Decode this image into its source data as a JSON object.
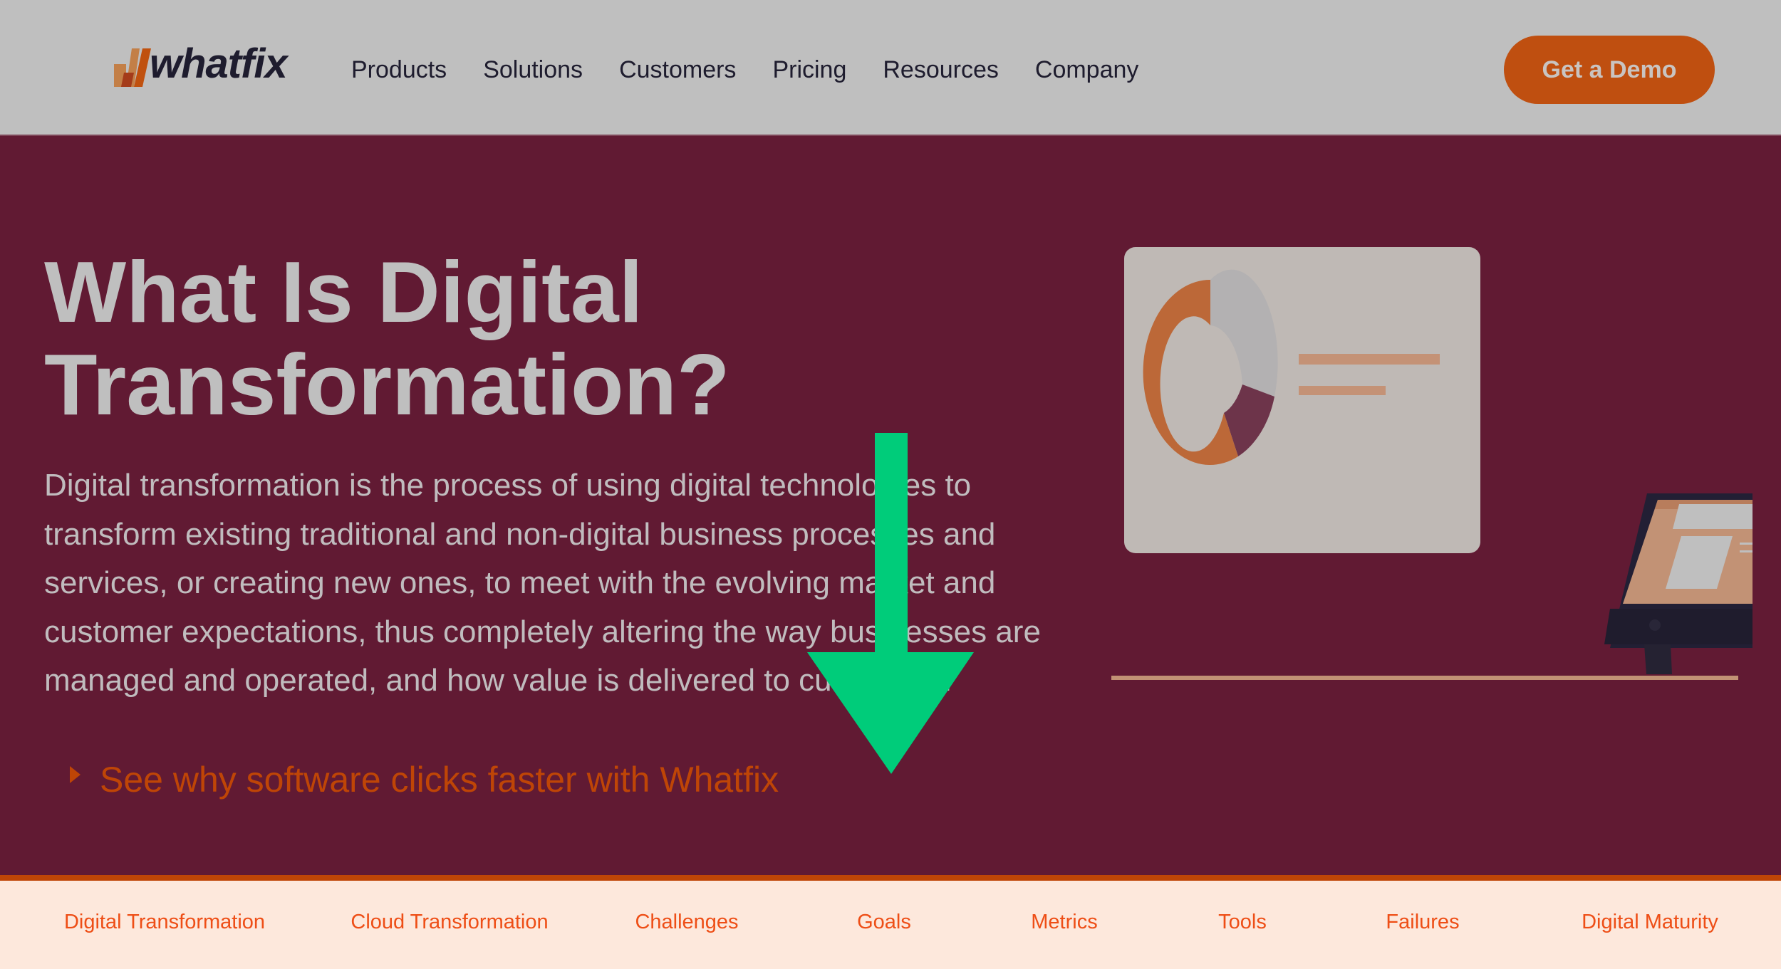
{
  "header": {
    "logo_text": "whatfix",
    "nav": [
      "Products",
      "Solutions",
      "Customers",
      "Pricing",
      "Resources",
      "Company"
    ],
    "cta_label": "Get a Demo"
  },
  "hero": {
    "title_line1": "What Is Digital",
    "title_line2": "Transformation?",
    "description": "Digital transformation is the process of using digital technologies to transform existing traditional and non-digital business processes and services, or creating new ones, to meet with the evolving market and customer expectations, thus completely altering the way businesses are managed and operated, and how value is delivered to customers.",
    "cta_link": "See why software clicks faster with Whatfix"
  },
  "topic_nav": [
    "Digital Transformation",
    "Cloud Transformation",
    "Challenges",
    "Goals",
    "Metrics",
    "Tools",
    "Failures",
    "Digital Maturity"
  ],
  "annotation": {
    "type": "arrow-down",
    "color": "#00cc7a",
    "points_to": "Goals"
  },
  "colors": {
    "header_bg": "#bfbfbf",
    "hero_bg": "#611a33",
    "accent": "#bf4f10",
    "topic_nav_bg": "#fde8dc",
    "topic_nav_text": "#ee4e16"
  }
}
